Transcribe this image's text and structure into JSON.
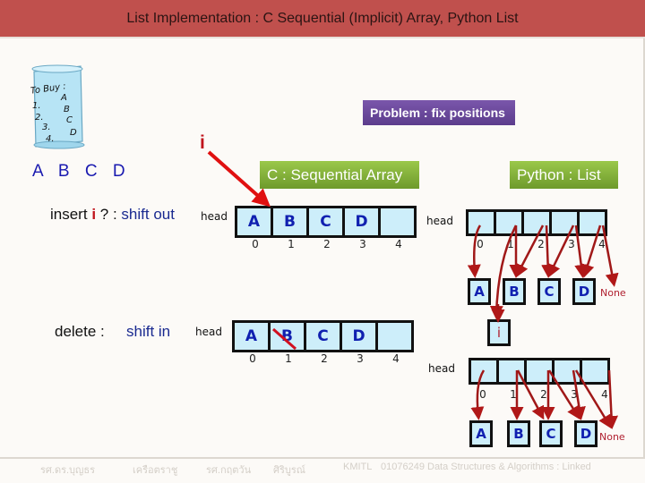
{
  "title": "List Implementation : C Sequential (Implicit) Array, Python List",
  "to_buy_note": {
    "heading": "To Buy :",
    "items": [
      {
        "num": "1.",
        "val": "A"
      },
      {
        "num": "2.",
        "val": "B"
      },
      {
        "num": "3.",
        "val": "C"
      },
      {
        "num": "4.",
        "val": "D"
      }
    ]
  },
  "abcd_label": "A B C D",
  "pointer_i": "i",
  "problem_label": "Problem : fix positions",
  "c_array_label": "C : Sequential Array",
  "python_label": "Python : List",
  "insert": {
    "prefix": "insert",
    "i": "i",
    "suffix": "? :",
    "action": "shift out",
    "head": "head",
    "cells": [
      "A",
      "B",
      "C",
      "D",
      ""
    ],
    "indices": [
      "0",
      "1",
      "2",
      "3",
      "4"
    ]
  },
  "delete": {
    "prefix": "delete :",
    "action": "shift in",
    "head": "head",
    "cells": [
      "A",
      "B",
      "C",
      "D",
      ""
    ],
    "indices": [
      "0",
      "1",
      "2",
      "3",
      "4"
    ]
  },
  "python_insert": {
    "head": "head",
    "indices": [
      "0",
      "1",
      "2",
      "3",
      "4"
    ],
    "nodes": [
      "A",
      "B",
      "C",
      "D"
    ],
    "none": "None",
    "new_node": "i"
  },
  "python_delete": {
    "head": "head",
    "indices": [
      "0",
      "1",
      "2",
      "3",
      "4"
    ],
    "nodes": [
      "A",
      "B",
      "C",
      "D"
    ],
    "none": "None",
    "new_node": "i"
  },
  "footer": {
    "author1": "รศ.ดร.บุญธร",
    "author1b": "เครือตราชู",
    "author2": "รศ.กฤตวัน",
    "author2b": "ศิริบูรณ์",
    "org": "KMITL",
    "course": "01076249 Data Structures & Algorithms : Linked"
  },
  "colors": {
    "title_bg": "#c0504d",
    "problem_bg": "#6b48a0",
    "label_green": "#8bb83e",
    "cell_fill": "#cdeefa",
    "arrow_red": "#b01818",
    "letter_blue": "#1020b0"
  }
}
